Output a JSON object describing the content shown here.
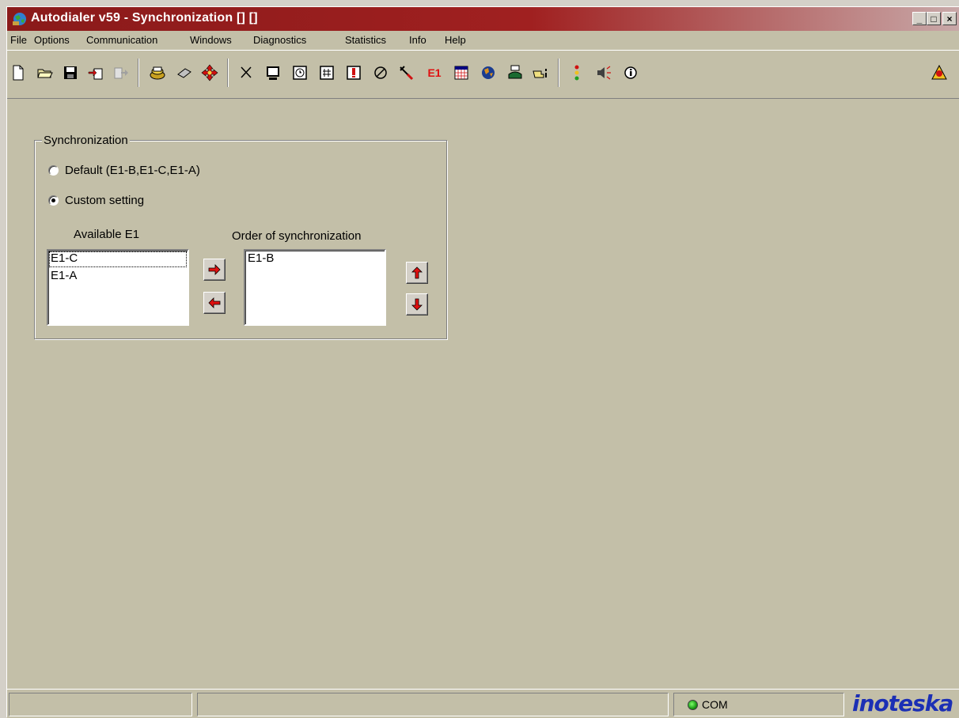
{
  "window": {
    "title": "Autodialer v59 - Synchronization [] []",
    "controls": {
      "minimize": "_",
      "maximize": "□",
      "close": "×"
    }
  },
  "menu": [
    "File",
    "Options",
    "Communication",
    "Windows",
    "Diagnostics",
    "Statistics",
    "Info",
    "Help"
  ],
  "toolbar": {
    "e1_label": "E1",
    "icons": [
      "new-file-icon",
      "open-folder-icon",
      "save-disk-icon",
      "import-icon",
      "export-icon",
      "printer-icon",
      "chip-icon",
      "move-arrows-icon",
      "cut-scissors-icon",
      "terminal-icon",
      "clock-icon",
      "hash-icon",
      "alert-icon",
      "link-icon",
      "tools-icon",
      "e1-icon",
      "calendar-grid-icon",
      "globe-icon",
      "cli-phone-icon",
      "pointer-hand-icon",
      "traffic-light-icon",
      "speaker-icon",
      "info-icon",
      "help-alert-icon"
    ]
  },
  "sync": {
    "group_title": "Synchronization",
    "option_default": "Default (E1-B,E1-C,E1-A)",
    "option_custom": "Custom setting",
    "selected": "custom",
    "available_label": "Available E1",
    "order_label": "Order of synchronization",
    "available": [
      "E1-C",
      "E1-A"
    ],
    "order": [
      "E1-B"
    ]
  },
  "statusbar": {
    "com_label": "COM",
    "brand": "inoteska",
    "led_color": "#22aa22"
  }
}
